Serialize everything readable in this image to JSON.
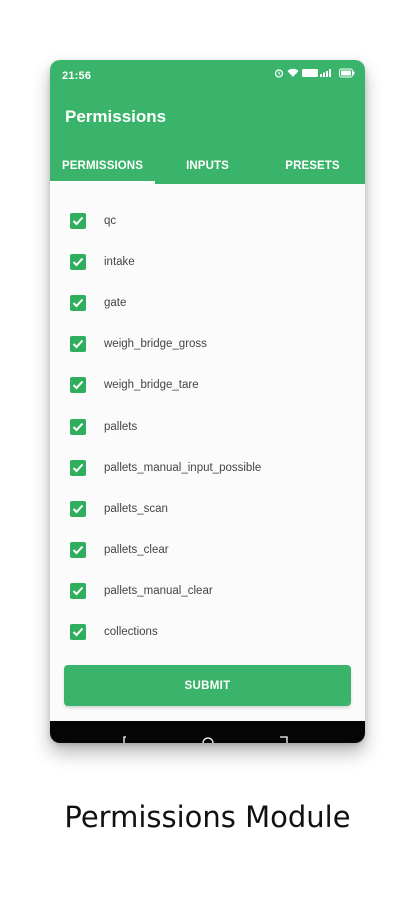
{
  "status_bar": {
    "time": "21:56"
  },
  "app": {
    "title": "Permissions"
  },
  "tabs": [
    {
      "label": "PERMISSIONS",
      "active": true
    },
    {
      "label": "INPUTS",
      "active": false
    },
    {
      "label": "PRESETS",
      "active": false
    }
  ],
  "permissions": [
    {
      "label": "qc",
      "checked": true
    },
    {
      "label": "intake",
      "checked": true
    },
    {
      "label": "gate",
      "checked": true
    },
    {
      "label": "weigh_bridge_gross",
      "checked": true
    },
    {
      "label": "weigh_bridge_tare",
      "checked": true
    },
    {
      "label": "pallets",
      "checked": true
    },
    {
      "label": "pallets_manual_input_possible",
      "checked": true
    },
    {
      "label": "pallets_scan",
      "checked": true
    },
    {
      "label": "pallets_clear",
      "checked": true
    },
    {
      "label": "pallets_manual_clear",
      "checked": true
    },
    {
      "label": "collections",
      "checked": true
    }
  ],
  "submit_label": "SUBMIT",
  "caption": "Permissions Module",
  "colors": {
    "primary": "#3ab46a",
    "checkbox": "#2fae5d",
    "navbar": "#050505"
  },
  "icons": [
    "alarm-icon",
    "wifi-icon",
    "signal-icon",
    "battery-icon",
    "back-icon",
    "home-icon",
    "recents-icon",
    "check-icon"
  ]
}
